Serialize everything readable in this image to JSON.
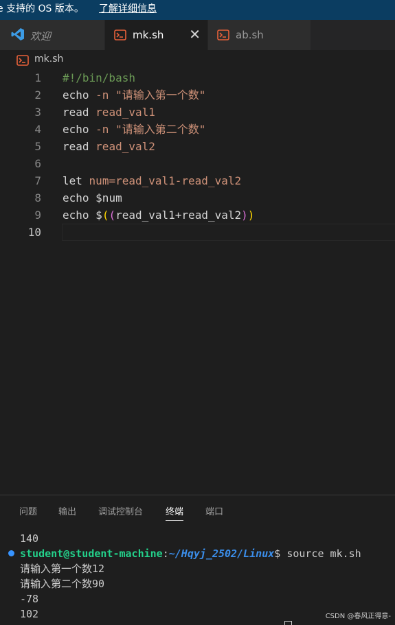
{
  "notification": {
    "message": "e 支持的 OS 版本。",
    "link": "了解详细信息"
  },
  "tabs": [
    {
      "label": "欢迎",
      "icon": "vscode-logo-icon",
      "active": false
    },
    {
      "label": "mk.sh",
      "icon": "terminal-file-icon",
      "active": true,
      "close": "✕"
    },
    {
      "label": "ab.sh",
      "icon": "terminal-file-icon",
      "active": false
    }
  ],
  "breadcrumb": {
    "file": "mk.sh"
  },
  "editor": {
    "line_numbers": [
      "1",
      "2",
      "3",
      "4",
      "5",
      "6",
      "7",
      "8",
      "9",
      "10"
    ],
    "current_line": "10",
    "lines": {
      "l1": "#!/bin/bash",
      "l2_cmd": "echo",
      "l2_opt": "-n",
      "l2_str": "\"请输入第一个数\"",
      "l3_cmd": "read",
      "l3_arg": "read_val1",
      "l4_cmd": "echo",
      "l4_opt": "-n",
      "l4_str": "\"请输入第二个数\"",
      "l5_cmd": "read",
      "l5_arg": "read_val2",
      "l7_cmd": "let",
      "l7_arg": "num=read_val1-read_val2",
      "l8_cmd": "echo",
      "l8_arg": "$num",
      "l9_cmd": "echo",
      "l9_dollar": "$",
      "l9_open1": "(",
      "l9_open2": "(",
      "l9_expr": "read_val1+read_val2",
      "l9_close2": ")",
      "l9_close1": ")"
    }
  },
  "panel": {
    "tabs": [
      "问题",
      "输出",
      "调试控制台",
      "终端",
      "端口"
    ],
    "active_tab": "终端",
    "terminal": {
      "line1": "140",
      "user": "student@student-machine",
      "colon": ":",
      "path": "~/Hqyj_2502/Linux",
      "cmd": "$ source mk.sh",
      "line3": "请输入第一个数12",
      "line4": "请输入第二个数90",
      "line5": "-78",
      "line6": "102"
    }
  },
  "watermark": "CSDN @春风正得意-",
  "colors": {
    "notification_bg": "#0b3d61",
    "editor_bg": "#1e1e1e",
    "string": "#ce9178",
    "comment": "#6a9955",
    "prompt_user": "#23d18b",
    "prompt_path": "#3b8eea"
  }
}
